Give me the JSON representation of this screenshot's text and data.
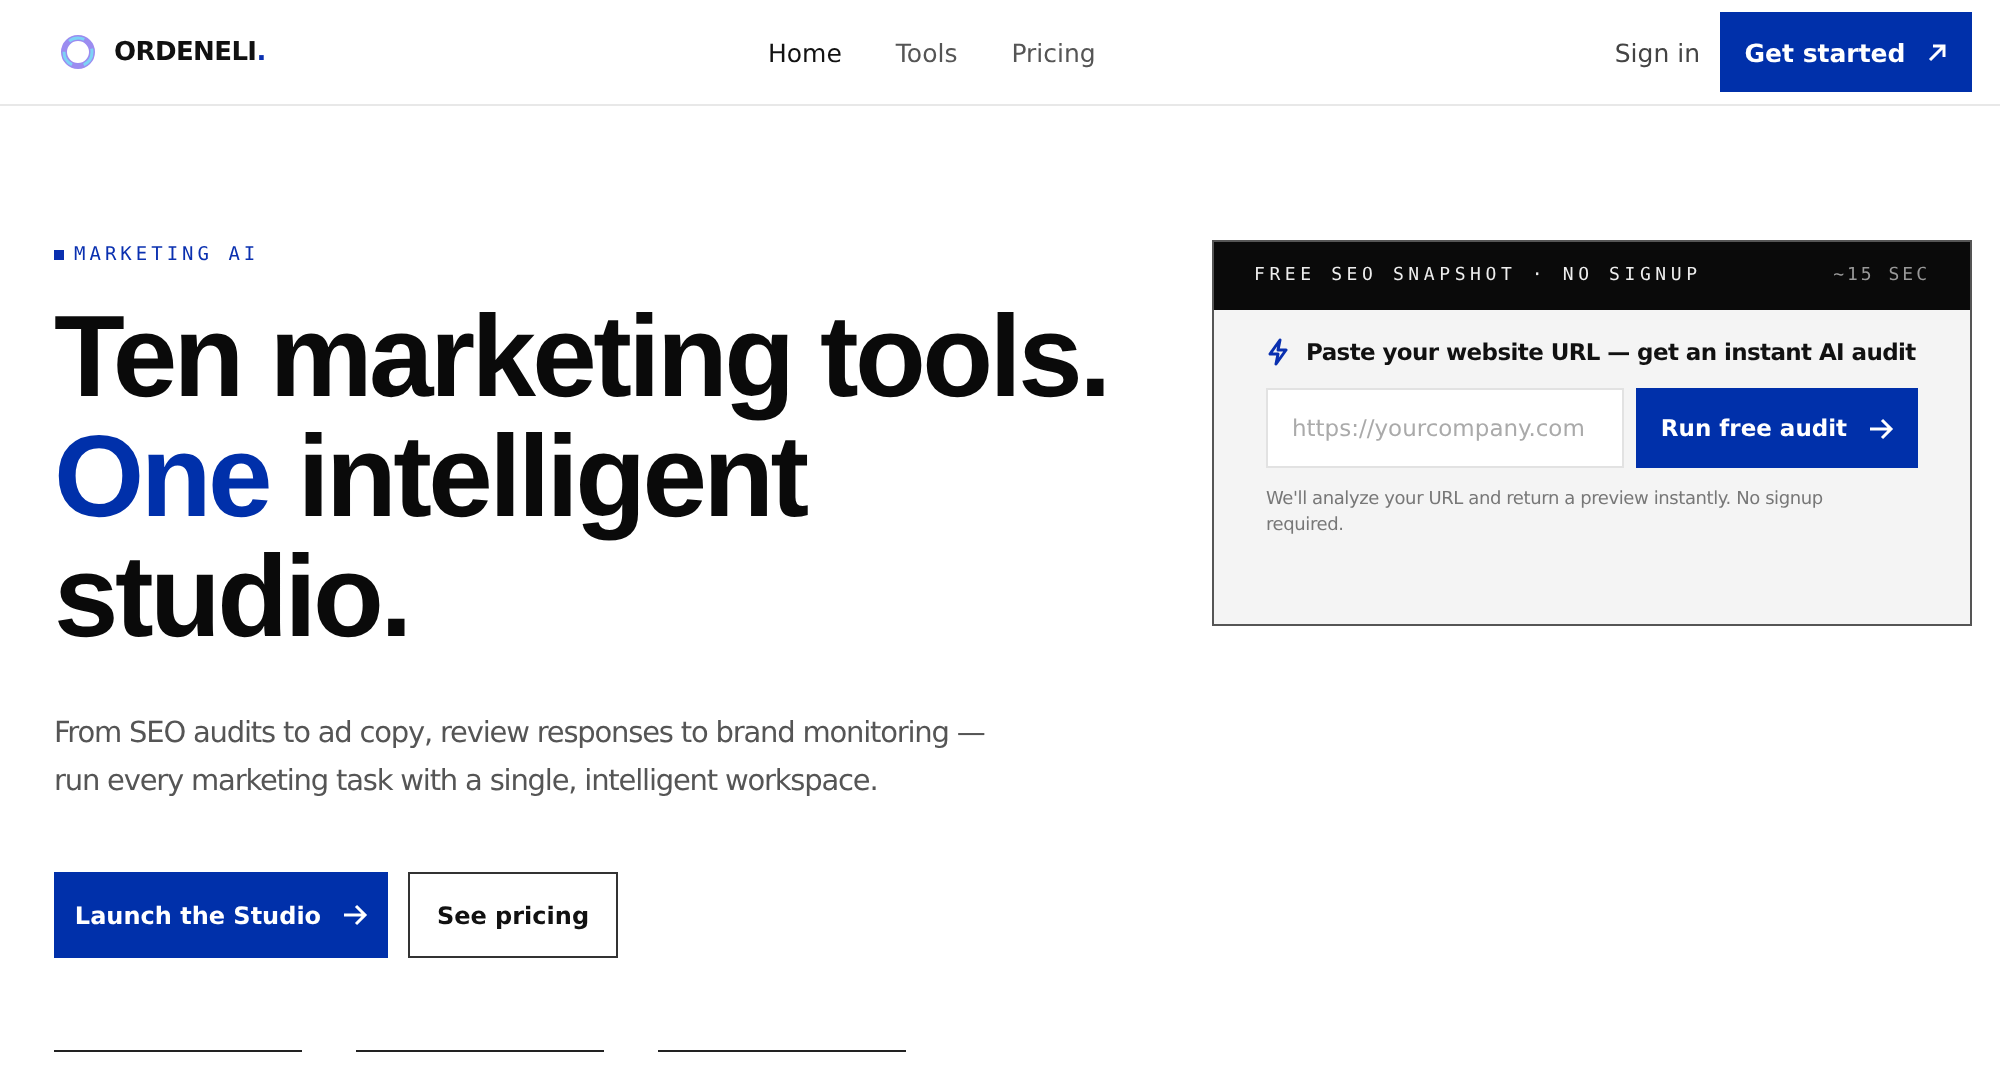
{
  "brand": {
    "name": "ORDENELI",
    "dot": "."
  },
  "nav": [
    {
      "label": "Home",
      "selected": true
    },
    {
      "label": "Tools",
      "selected": false
    },
    {
      "label": "Pricing",
      "selected": false
    }
  ],
  "sign_in": "Sign in",
  "get_started": "Get started",
  "eyebrow": "MARKETING AI",
  "headline": {
    "line1": "Ten marketing tools.",
    "accent": "One",
    "line2_rest": " intelligent",
    "line3": "studio."
  },
  "description": "From SEO audits to ad copy, review responses to brand monitoring — run every marketing task with a single, intelligent workspace.",
  "buttons": {
    "primary": "Launch the Studio",
    "secondary": "See pricing"
  },
  "card": {
    "header": "FREE SEO SNAPSHOT · NO SIGNUP",
    "time": "~15 SEC",
    "title": "Paste your website URL — get an instant AI audit",
    "placeholder": "https://yourcompany.com",
    "button": "Run free audit",
    "note": "We'll analyze your URL and return a preview instantly. No signup required."
  }
}
